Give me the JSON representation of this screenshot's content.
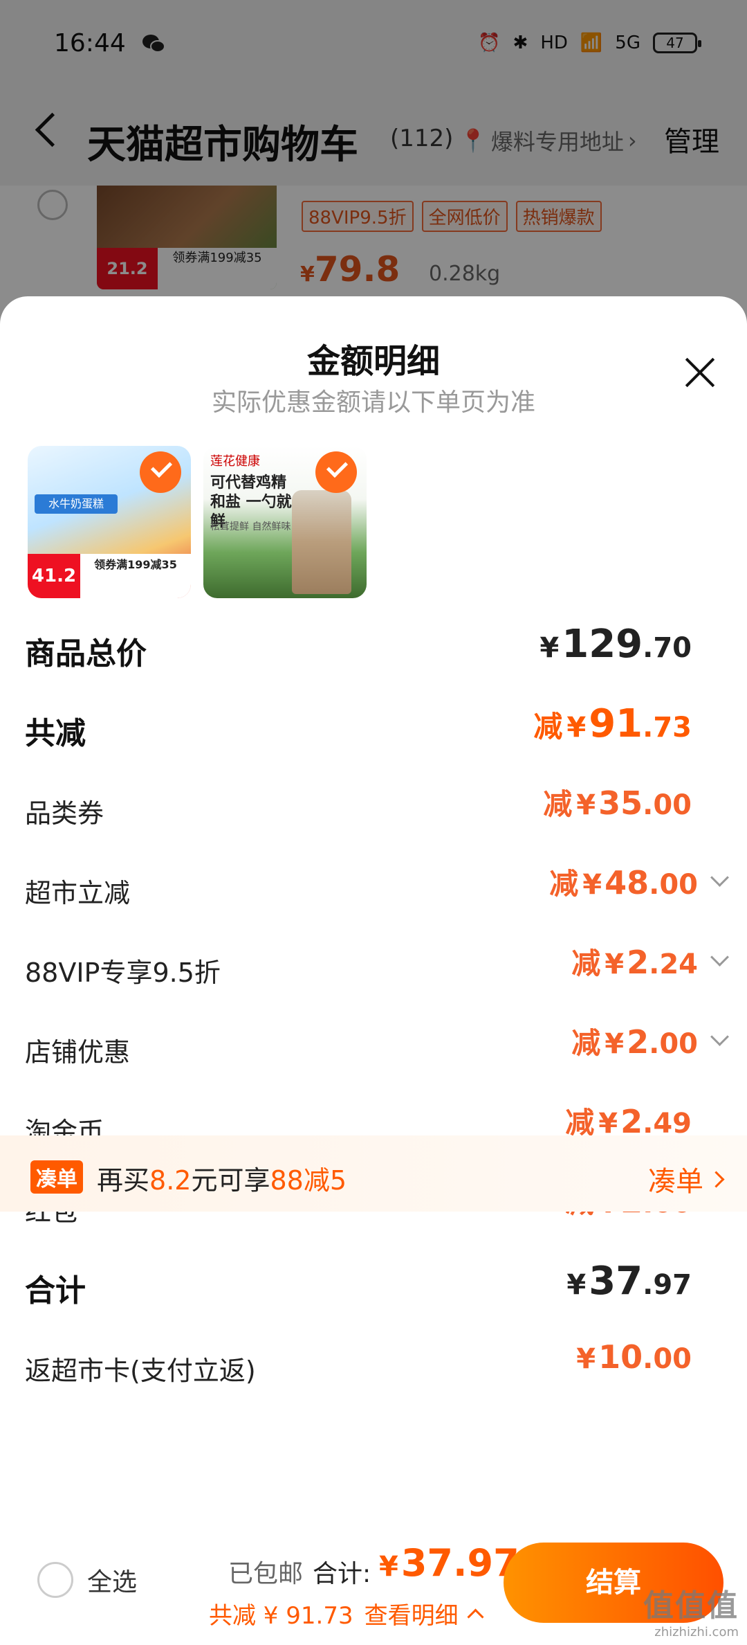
{
  "status": {
    "time": "16:44",
    "battery": "47",
    "net": "5G",
    "hd": "HD"
  },
  "nav": {
    "title": "天猫超市购物车",
    "count": "(112)",
    "address": "爆料专用地址",
    "manage": "管理"
  },
  "cart_item": {
    "tags": [
      "88VIP9.5折",
      "全网低价",
      "热销爆款"
    ],
    "price_cur": "¥",
    "price": "79.8",
    "weight": "0.28kg",
    "thumb_badge": "21.2",
    "thumb_band": "领券满199减35"
  },
  "sheet": {
    "title": "金额明细",
    "subtitle": "实际优惠金额请以下单页为准",
    "thumb1": {
      "badge": "41.2",
      "band": "领券满199减35",
      "label": "水牛奶蛋糕"
    },
    "thumb2": {
      "brand": "莲花健康",
      "text": "可代替鸡精和盐 一勺就鲜",
      "small": "松茸提鲜 自然鲜味"
    },
    "rows": [
      {
        "label": "商品总价",
        "prefix": "",
        "cur": "¥",
        "int": "129",
        "dec": ".70"
      },
      {
        "label": "共减",
        "prefix": "减",
        "cur": "¥",
        "int": "91",
        "dec": ".73"
      },
      {
        "label": "品类券",
        "prefix": "减",
        "cur": "¥",
        "int": "35",
        "dec": ".00"
      },
      {
        "label": "超市立减",
        "prefix": "减",
        "cur": "¥",
        "int": "48",
        "dec": ".00"
      },
      {
        "label": "88VIP专享9.5折",
        "prefix": "减",
        "cur": "¥",
        "int": "2",
        "dec": ".24"
      },
      {
        "label": "店铺优惠",
        "prefix": "减",
        "cur": "¥",
        "int": "2",
        "dec": ".00"
      },
      {
        "label": "淘金币",
        "prefix": "减",
        "cur": "¥",
        "int": "2",
        "dec": ".49"
      },
      {
        "label": "红包",
        "prefix": "减",
        "cur": "¥",
        "int": "2",
        "dec": ".00"
      },
      {
        "label": "合计",
        "prefix": "",
        "cur": "¥",
        "int": "37",
        "dec": ".97"
      },
      {
        "label": "返超市卡(支付立返)",
        "prefix": "",
        "cur": "¥",
        "int": "10",
        "dec": ".00"
      }
    ]
  },
  "promo": {
    "badge": "凑单",
    "text_a": "再买",
    "amount": "8.2",
    "text_b": "元可享",
    "deal": "88减5",
    "link": "凑单"
  },
  "bottom": {
    "select_all": "全选",
    "shipping": "已包邮",
    "total_label": "合计:",
    "total_cur": "¥",
    "total": "37.97",
    "reduce": "共减 ¥ 91.73",
    "detail": "查看明细",
    "checkout": "结算"
  },
  "watermark": {
    "line1": "值值值",
    "line2": "zhizhizhi.com"
  },
  "colors": {
    "accent": "#ff5a00",
    "checkout_start": "#ff9200",
    "checkout_end": "#ff5000"
  }
}
